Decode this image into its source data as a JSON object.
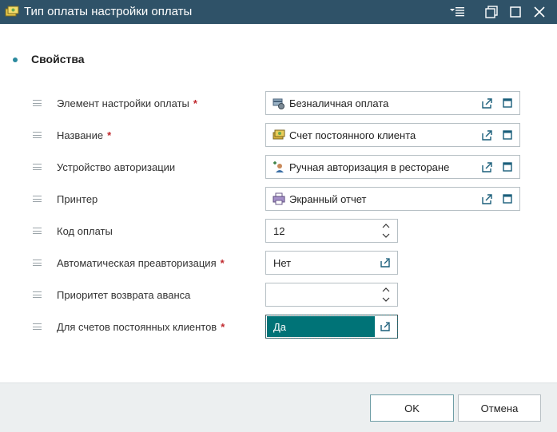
{
  "window": {
    "title": "Тип оплаты настройки оплаты",
    "icon": "payment-type-icon"
  },
  "section": {
    "title": "Свойства"
  },
  "fields": [
    {
      "label": "Элемент настройки оплаты",
      "required": "*",
      "value": "Безналичная оплата",
      "icon": "card-payment-icon",
      "control": "reference"
    },
    {
      "label": "Название",
      "required": "*",
      "value": "Счет постоянного клиента",
      "icon": "money-icon",
      "control": "reference"
    },
    {
      "label": "Устройство авторизации",
      "required": "",
      "value": "Ручная авторизация в ресторане",
      "icon": "manual-auth-icon",
      "control": "reference"
    },
    {
      "label": "Принтер",
      "required": "",
      "value": "Экранный отчет",
      "icon": "printer-icon",
      "control": "reference"
    },
    {
      "label": "Код оплаты",
      "required": "",
      "value": "12",
      "control": "spinner"
    },
    {
      "label": "Автоматическая преавторизация",
      "required": "*",
      "value": "Нет",
      "control": "dropdown"
    },
    {
      "label": "Приоритет возврата аванса",
      "required": "",
      "value": "",
      "control": "spinner"
    },
    {
      "label": "Для счетов постоянных клиентов",
      "required": "*",
      "value": "Да",
      "control": "dropdown",
      "selected": true
    }
  ],
  "buttons": {
    "ok": "OK",
    "cancel": "Отмена"
  },
  "colors": {
    "titlebar": "#2f5268",
    "accent": "#007377",
    "required": "#c0282d",
    "footer": "#eceff0"
  }
}
